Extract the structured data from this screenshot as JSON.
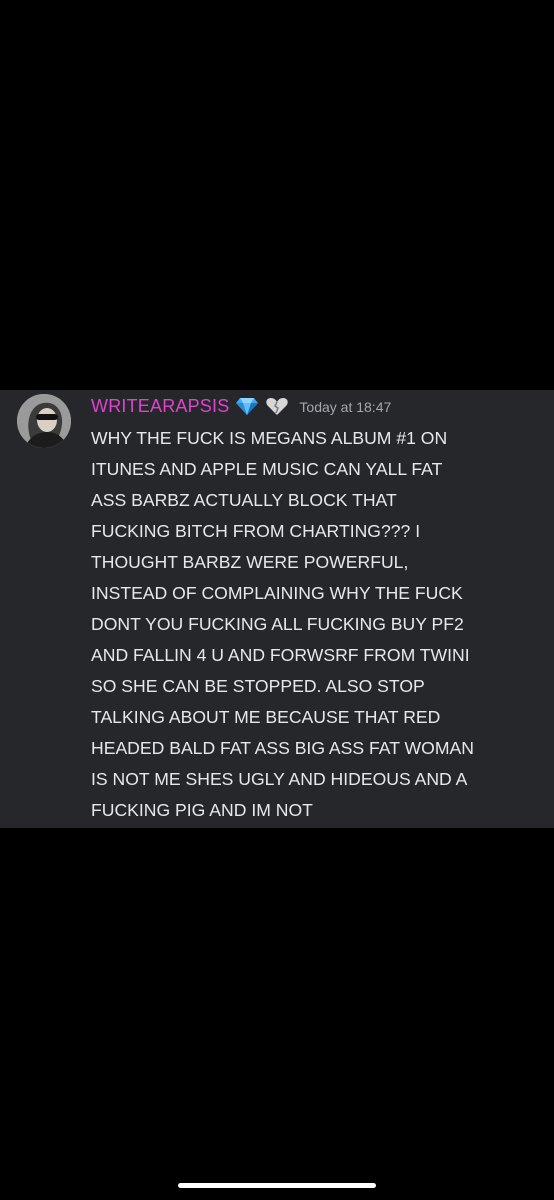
{
  "message": {
    "username": "WRITEARAPSIS",
    "badges": [
      "gem-icon",
      "broken-heart-icon"
    ],
    "timestamp": "Today at 18:47",
    "lines": [
      "WHY THE FUCK IS MEGANS ALBUM #1 ON",
      "ITUNES AND APPLE MUSIC CAN YALL FAT",
      "ASS BARBZ ACTUALLY BLOCK THAT",
      "FUCKING BITCH FROM CHARTING??? I",
      "THOUGHT BARBZ WERE POWERFUL,",
      "INSTEAD OF COMPLAINING WHY THE FUCK",
      "DONT YOU FUCKING ALL FUCKING BUY PF2",
      "AND FALLIN 4 U AND FORWSRF FROM TWINI",
      "SO SHE CAN BE STOPPED. ALSO STOP",
      "TALKING ABOUT ME BECAUSE THAT RED",
      "HEADED BALD FAT ASS BIG ASS FAT WOMAN",
      "IS NOT ME SHES UGLY AND HIDEOUS AND A",
      "FUCKING PIG AND IM NOT"
    ]
  },
  "colors": {
    "background": "#000000",
    "card": "#26272b",
    "username": "#e142cf",
    "text": "#e7e8ea",
    "timestamp": "#a5a7ac"
  }
}
